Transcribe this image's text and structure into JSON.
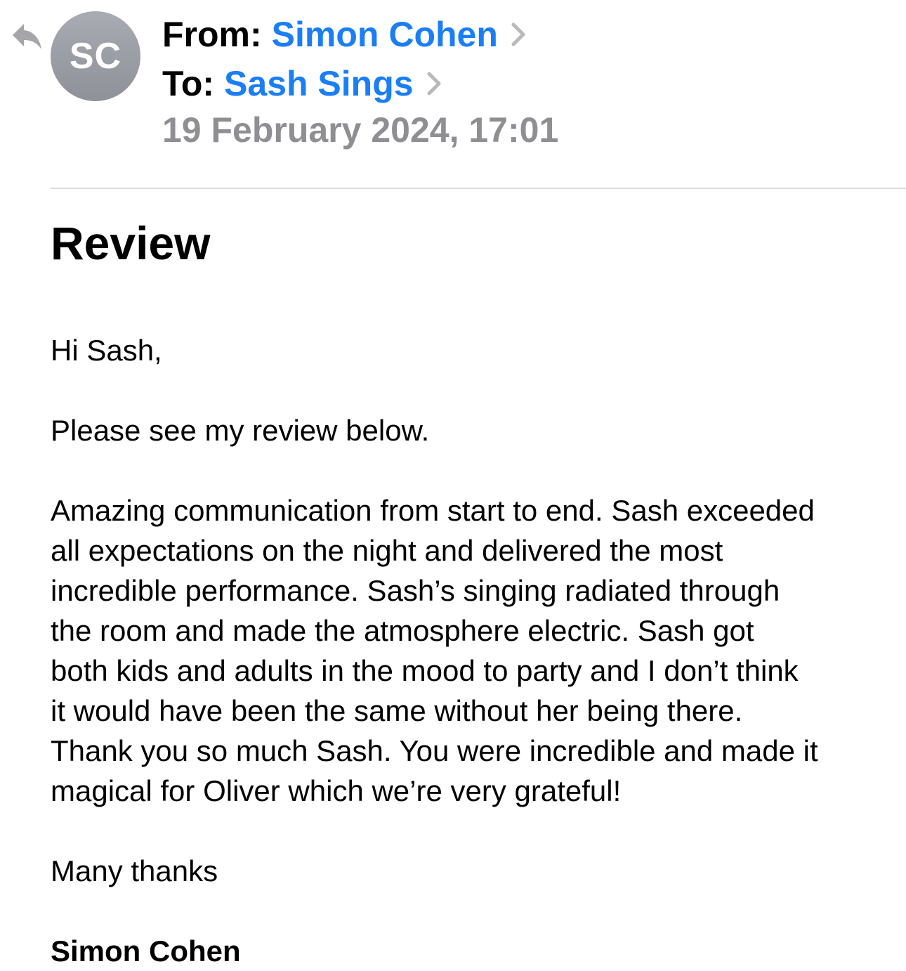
{
  "email": {
    "avatar": {
      "initials": "SC",
      "color": "#9a9ca4"
    },
    "from_label": "From:",
    "from_name": "Simon Cohen",
    "to_label": "To:",
    "to_name": "Sash Sings",
    "date": "19 February 2024, 17:01",
    "subject": "Review",
    "body": {
      "greeting": "Hi Sash,",
      "intro": "Please see my review below.",
      "review_lines": [
        "Amazing communication from start to end. Sash exceeded",
        "all expectations on the night and delivered the most",
        "incredible performance. Sash’s singing radiated through",
        "the room and made the atmosphere electric. Sash got",
        "both kids and adults in the mood to party and I don’t think",
        "it would have been the same without her being there.",
        "Thank you so much Sash. You were incredible and made it",
        "magical for Oliver which we’re very grateful!"
      ],
      "signoff": "Many thanks",
      "signature": "Simon Cohen"
    }
  },
  "icons": {
    "reply": "reply-arrow-icon",
    "from_chevron": "chevron-right-icon",
    "to_chevron": "chevron-right-icon"
  },
  "colors": {
    "link": "#1a7ef5",
    "secondary_text": "#8e8e93",
    "divider": "#dcdcdf",
    "chevron": "#b8b8bd"
  }
}
